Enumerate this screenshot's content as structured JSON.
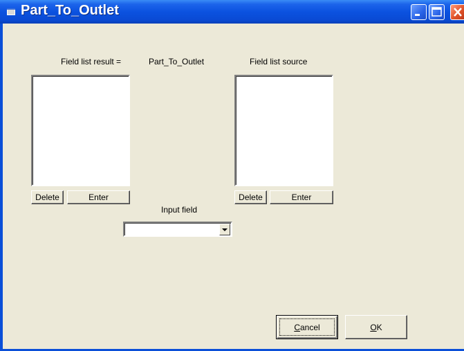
{
  "window": {
    "title": "Part_To_Outlet"
  },
  "labels": {
    "result_header": "Field list result =",
    "name": "Part_To_Outlet",
    "source_header": "Field list source",
    "input_field": "Input field"
  },
  "left_buttons": {
    "delete": "Delete",
    "enter": "Enter"
  },
  "right_buttons": {
    "delete": "Delete",
    "enter": "Enter"
  },
  "input_field_combo": {
    "value": ""
  },
  "dialog_buttons": {
    "cancel_accel": "C",
    "cancel_rest": "ancel",
    "ok_accel": "O",
    "ok_rest": "K"
  },
  "icons": [
    "window-icon",
    "minimize-icon",
    "maximize-icon",
    "close-icon",
    "dropdown-arrow-icon"
  ]
}
